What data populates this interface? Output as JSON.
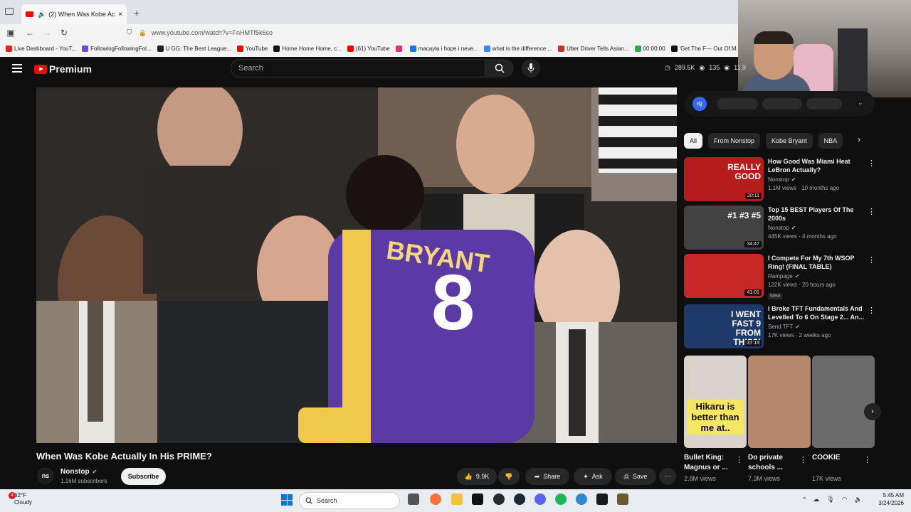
{
  "browser": {
    "tab_title": "(2) When Was Kobe Actuall",
    "tab_close": "×",
    "new_tab": "+",
    "url": "www.youtube.com/watch?v=FnHMTf5k6so",
    "bookmarks": [
      {
        "label": "Live Dashboard - YouT...",
        "color": "#e62117"
      },
      {
        "label": "FollowingFollowingFol...",
        "color": "#7a3df0"
      },
      {
        "label": "U GG: The Best League...",
        "color": "#222222"
      },
      {
        "label": "YouTube",
        "color": "#ff0000"
      },
      {
        "label": "Home Home Home, c...",
        "color": "#111111"
      },
      {
        "label": "(61) YouTube",
        "color": "#ff0000"
      },
      {
        "label": "",
        "color": "#e1306c"
      },
      {
        "label": "macayla i hope i neve...",
        "color": "#1a73e8"
      },
      {
        "label": "what is the difference ...",
        "color": "#4285f4"
      },
      {
        "label": "Uber Driver Tells Asian...",
        "color": "#c9302c"
      },
      {
        "label": "00:00:00",
        "color": "#34a853"
      },
      {
        "label": "'Get The F--- Out Of M...",
        "color": "#111111"
      }
    ]
  },
  "youtube": {
    "logo_text": "Premium",
    "search_placeholder": "Search",
    "stats": {
      "views": "289.5K",
      "viewers": "135",
      "other": "11.9"
    },
    "video_title": "When Was Kobe Actually In His PRIME?",
    "channel": {
      "logo": "ns",
      "name": "Nonstop",
      "subscribers": "1.16M subscribers"
    },
    "subscribe_label": "Subscribe",
    "actions": {
      "likes": "9.9K",
      "share": "Share",
      "ask": "Ask",
      "save": "Save",
      "more": "···"
    },
    "iq_badge": "iQ",
    "chips": [
      "All",
      "From Nonstop",
      "Kobe Bryant",
      "NBA"
    ],
    "chip_next": "›",
    "recommendations": [
      {
        "title": "How Good Was Miami Heat LeBron Actually?",
        "channel": "Nonstop",
        "meta": "1.1M views · 10 months ago",
        "duration": "20:11",
        "new": "",
        "thumb_text": "REALLY GOOD",
        "color": "#b71c1c"
      },
      {
        "title": "Top 15 BEST Players Of The 2000s",
        "channel": "Nonstop",
        "meta": "445K views · 4 months ago",
        "duration": "34:47",
        "new": "",
        "thumb_text": "#1 #3 #5",
        "color": "#424242"
      },
      {
        "title": "I Compete For My 7th WSOP Ring! (FINAL TABLE)",
        "channel": "Rampage",
        "meta": "122K views · 20 hours ago",
        "duration": "41:01",
        "new": "New",
        "thumb_text": "",
        "color": "#c62828"
      },
      {
        "title": "I Broke TFT Fundamentals And Levelled To 6 On Stage 2... An...",
        "channel": "Send TFT",
        "meta": "17K views · 2 weeks ago",
        "duration": "37:14",
        "new": "",
        "thumb_text": "I WENT FAST 9 FROM THIS?!",
        "color": "#1e3a6b"
      }
    ],
    "shorts": [
      {
        "title": "Bullet King: Magnus or ...",
        "views": "2.8M views",
        "thumb_text": "Hikaru is better than me at..",
        "color": "#d9d3cc"
      },
      {
        "title": "Do private schools ...",
        "views": "7.3M views",
        "thumb_text": "",
        "color": "#b6866d"
      },
      {
        "title": "COOKIE",
        "views": "17K views",
        "thumb_text": "",
        "color": "#6b6b6b"
      }
    ],
    "shorts_next": "›"
  },
  "taskbar": {
    "weather_temp": "62°F",
    "weather_desc": "Cloudy",
    "weather_alert": "4",
    "search_label": "Search",
    "time": "5:45 AM",
    "date": "3/24/2026"
  }
}
